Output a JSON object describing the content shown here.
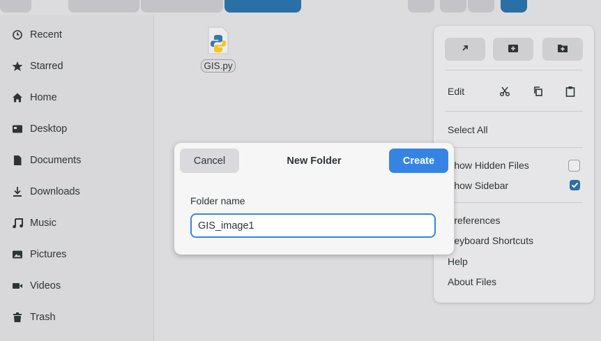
{
  "sidebar": {
    "items": [
      {
        "label": "Recent",
        "icon": "clock-icon"
      },
      {
        "label": "Starred",
        "icon": "star-icon"
      },
      {
        "label": "Home",
        "icon": "home-icon"
      },
      {
        "label": "Desktop",
        "icon": "desktop-icon"
      },
      {
        "label": "Documents",
        "icon": "document-icon"
      },
      {
        "label": "Downloads",
        "icon": "download-icon"
      },
      {
        "label": "Music",
        "icon": "music-icon"
      },
      {
        "label": "Pictures",
        "icon": "picture-icon"
      },
      {
        "label": "Videos",
        "icon": "video-icon"
      },
      {
        "label": "Trash",
        "icon": "trash-icon"
      }
    ]
  },
  "content": {
    "files": [
      {
        "name": "GIS.py",
        "icon": "python-file-icon"
      }
    ]
  },
  "menu": {
    "top_buttons": [
      {
        "icon": "open-external-icon"
      },
      {
        "icon": "new-window-icon"
      },
      {
        "icon": "new-folder-icon"
      }
    ],
    "edit_label": "Edit",
    "edit_icons": [
      "cut-icon",
      "copy-icon",
      "paste-icon"
    ],
    "select_all": "Select All",
    "show_hidden_files": "Show Hidden Files",
    "show_hidden_files_checked": false,
    "show_sidebar": "Show Sidebar",
    "show_sidebar_checked": true,
    "preferences": "Preferences",
    "keyboard_shortcuts": "Keyboard Shortcuts",
    "help": "Help",
    "about": "About Files"
  },
  "dialog": {
    "cancel_label": "Cancel",
    "title": "New Folder",
    "create_label": "Create",
    "field_label": "Folder name",
    "folder_name_value": "GIS_image1"
  },
  "colors": {
    "accent": "#3584e4",
    "header_accent": "#2a6fa6",
    "checkbox_on": "#2a6fa6"
  }
}
